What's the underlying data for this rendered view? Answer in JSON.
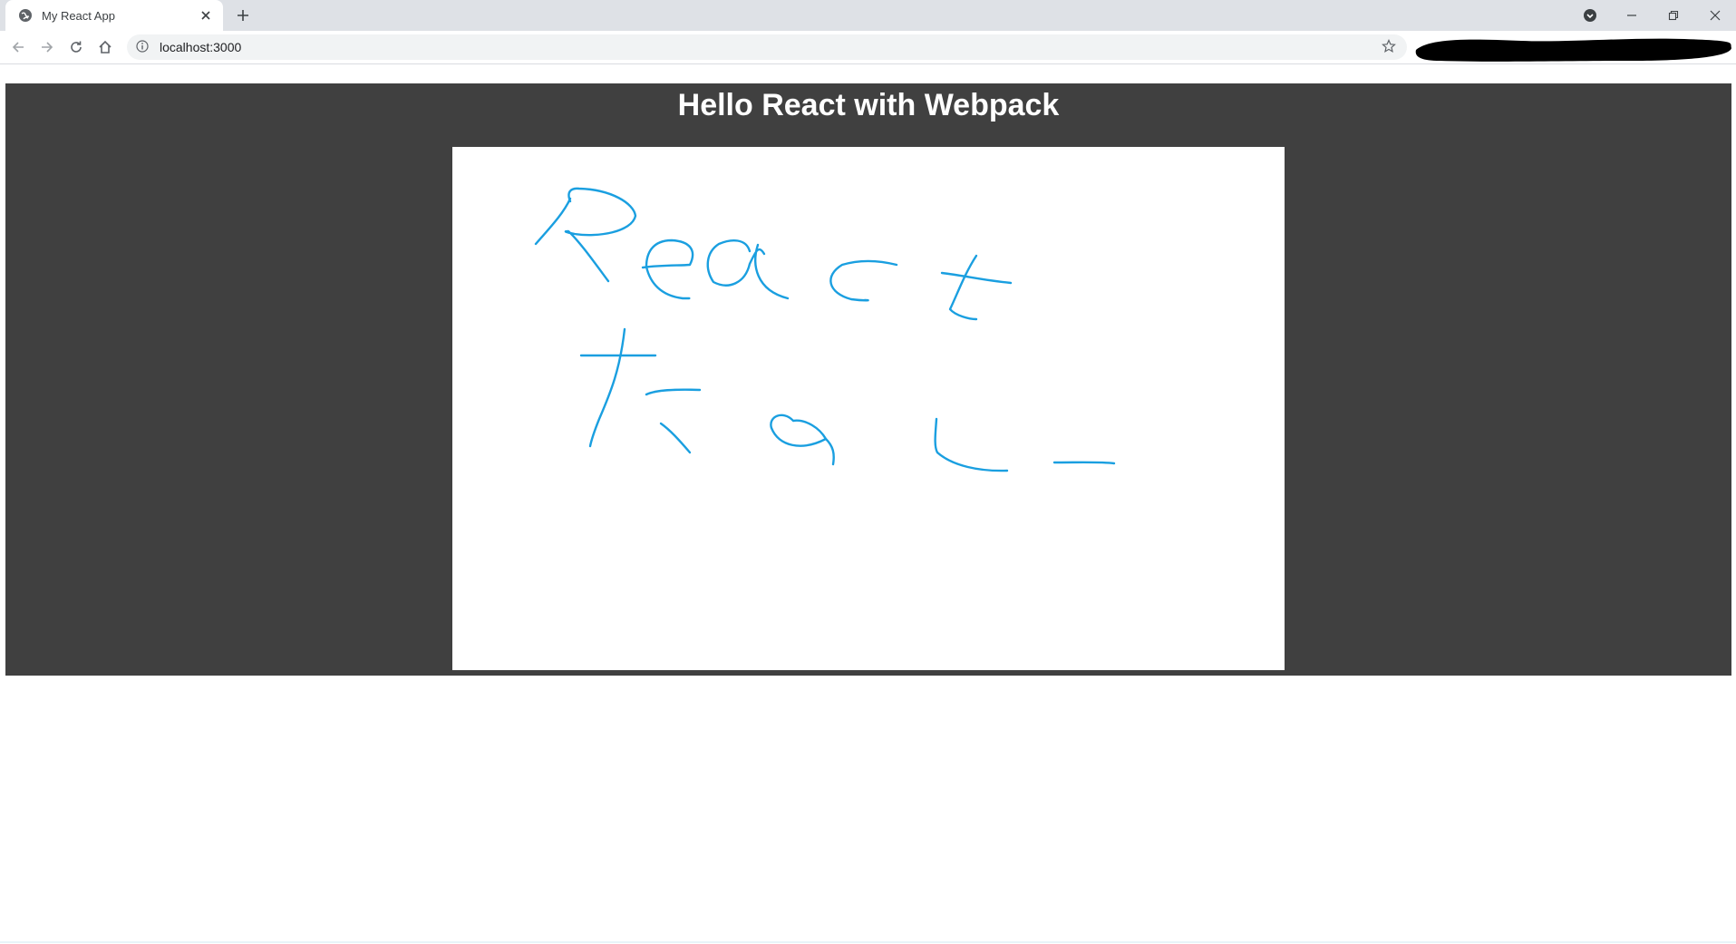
{
  "browser": {
    "tab": {
      "title": "My React App",
      "favicon": "globe-icon"
    },
    "address": {
      "url": "localhost:3000"
    },
    "icons": {
      "back": "arrow-left-icon",
      "forward": "arrow-right-icon",
      "reload": "reload-icon",
      "home": "home-icon",
      "info": "info-icon",
      "bookmark": "star-icon",
      "new_tab": "plus-icon",
      "profile_menu": "chevron-down-icon"
    }
  },
  "page": {
    "heading": "Hello React with Webpack",
    "background_color": "#404040",
    "canvas": {
      "background": "#ffffff",
      "stroke_color": "#1a9fe0",
      "drawn_text": "React Tool"
    }
  }
}
